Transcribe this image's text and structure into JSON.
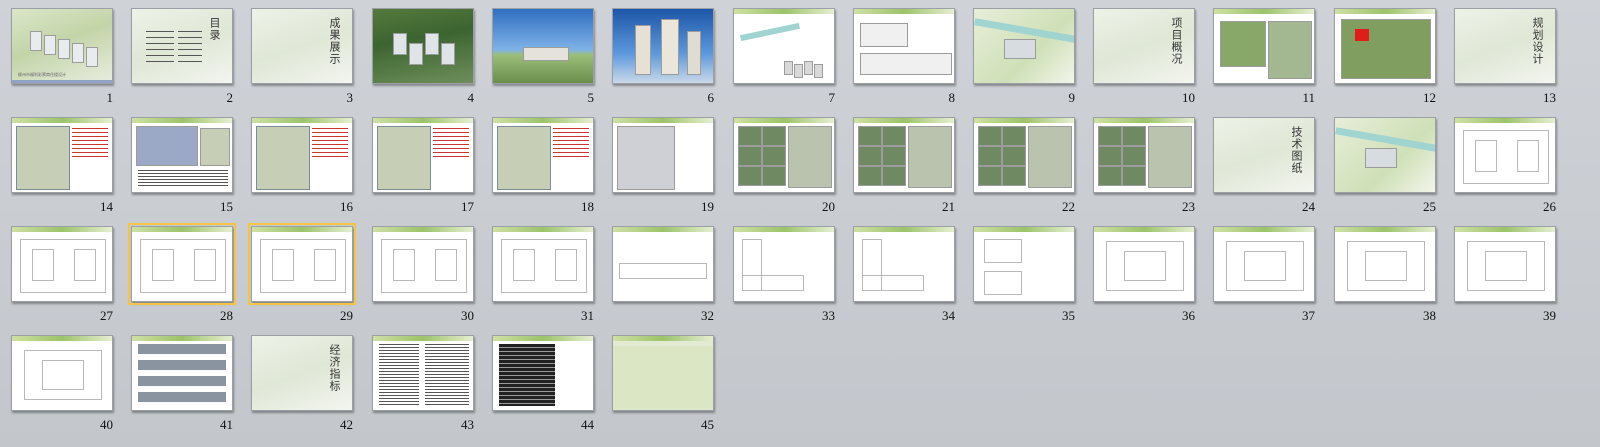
{
  "window": {
    "view": "slide-sorter"
  },
  "slides": [
    {
      "number": "1",
      "caption": "柳州市福利彩票商住楼设计"
    },
    {
      "number": "2",
      "title": "目录"
    },
    {
      "number": "3",
      "title": "成果展示"
    },
    {
      "number": "4"
    },
    {
      "number": "5"
    },
    {
      "number": "6"
    },
    {
      "number": "7"
    },
    {
      "number": "8"
    },
    {
      "number": "9"
    },
    {
      "number": "10",
      "title": "项目概况"
    },
    {
      "number": "11"
    },
    {
      "number": "12"
    },
    {
      "number": "13",
      "title": "规划设计"
    },
    {
      "number": "14"
    },
    {
      "number": "15"
    },
    {
      "number": "16"
    },
    {
      "number": "17"
    },
    {
      "number": "18"
    },
    {
      "number": "19"
    },
    {
      "number": "20"
    },
    {
      "number": "21"
    },
    {
      "number": "22"
    },
    {
      "number": "23"
    },
    {
      "number": "24",
      "title": "技术图纸"
    },
    {
      "number": "25"
    },
    {
      "number": "26"
    },
    {
      "number": "27"
    },
    {
      "number": "28"
    },
    {
      "number": "29"
    },
    {
      "number": "30"
    },
    {
      "number": "31"
    },
    {
      "number": "32"
    },
    {
      "number": "33"
    },
    {
      "number": "34"
    },
    {
      "number": "35"
    },
    {
      "number": "36"
    },
    {
      "number": "37"
    },
    {
      "number": "38"
    },
    {
      "number": "39"
    },
    {
      "number": "40"
    },
    {
      "number": "41"
    },
    {
      "number": "42",
      "title": "经济指标"
    },
    {
      "number": "43"
    },
    {
      "number": "44"
    },
    {
      "number": "45"
    }
  ],
  "selected_slides": [
    "28",
    "29"
  ]
}
